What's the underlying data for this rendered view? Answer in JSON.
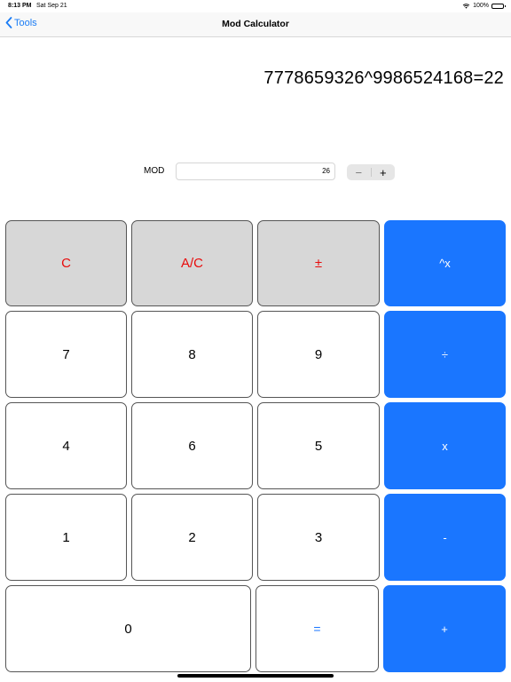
{
  "status": {
    "time": "8:13 PM",
    "date": "Sat Sep 21",
    "battery": "100%",
    "battery_level": 1.0
  },
  "nav": {
    "back_label": "Tools",
    "title": "Mod Calculator"
  },
  "display": {
    "expression": "7778659326^9986524168=22"
  },
  "mod": {
    "label": "MOD",
    "value": "26",
    "stepper_minus": "−",
    "stepper_plus": "+"
  },
  "keys": {
    "clear": "C",
    "all_clear": "A/C",
    "plus_minus": "±",
    "power": "^x",
    "seven": "7",
    "eight": "8",
    "nine": "9",
    "divide": "÷",
    "four": "4",
    "six": "6",
    "five": "5",
    "multiply": "x",
    "one": "1",
    "two": "2",
    "three": "3",
    "subtract": "-",
    "zero": "0",
    "equals": "=",
    "add": "+"
  },
  "colors": {
    "accent": "#1a76ff",
    "function_key_bg": "#d7d7d7",
    "function_key_text": "#e80b0b"
  }
}
